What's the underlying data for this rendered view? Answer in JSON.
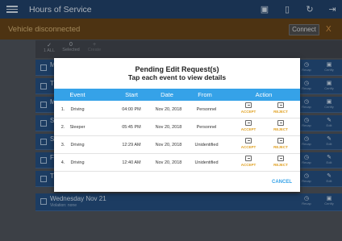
{
  "header": {
    "title": "Hours of Service",
    "icons": [
      "chat-icon",
      "device-icon",
      "refresh-icon",
      "logout-icon"
    ]
  },
  "status": {
    "message": "Vehicle disconnected",
    "connect_label": "Connect",
    "close_label": "X"
  },
  "toolbar": {
    "items": [
      {
        "count": "",
        "label": "1 ALL"
      },
      {
        "count": "0",
        "label": "Selected"
      },
      {
        "count": "",
        "label": "Create"
      }
    ]
  },
  "rows": [
    {
      "prefix": "M"
    },
    {
      "prefix": "T"
    },
    {
      "prefix": "M"
    },
    {
      "prefix": "S"
    },
    {
      "prefix": "S"
    },
    {
      "prefix": "F"
    },
    {
      "prefix": "T"
    },
    {
      "title": "Wednesday Nov 21",
      "subtitle": "Violation: none"
    }
  ],
  "row_icon_labels": {
    "recap": "Recap",
    "certify": "Certify",
    "edit": "Edit"
  },
  "dialog": {
    "title": "Pending Edit Request(s)",
    "subtitle": "Tap each event to view details",
    "columns": [
      "Event",
      "Start",
      "Date",
      "From",
      "Action"
    ],
    "rows": [
      {
        "num": "1.",
        "event": "Driving",
        "start": "04:00 PM",
        "date": "Nov 20, 2018",
        "from": "Personnel"
      },
      {
        "num": "2.",
        "event": "Sleeper",
        "start": "05:45 PM",
        "date": "Nov 20, 2018",
        "from": "Personnel"
      },
      {
        "num": "3.",
        "event": "Driving",
        "start": "12:29 AM",
        "date": "Nov 20, 2018",
        "from": "Unidentified"
      },
      {
        "num": "4.",
        "event": "Driving",
        "start": "12:40 AM",
        "date": "Nov 20, 2018",
        "from": "Unidentified"
      }
    ],
    "accept_label": "ACCEPT",
    "reject_label": "REJECT",
    "cancel_label": "CANCEL"
  }
}
